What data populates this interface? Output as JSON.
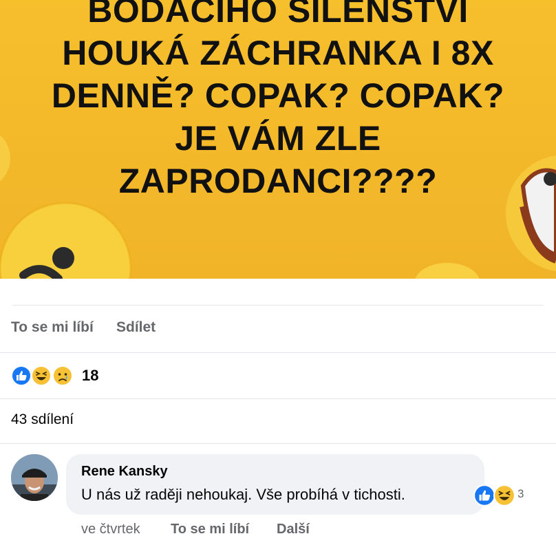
{
  "post_image": {
    "lines": [
      "BODACÍHO ŠÍLENSTVÍ",
      "HOUKÁ ZÁCHRANKA I 8X",
      "DENNĚ? COPAK? COPAK?",
      "JE VÁM ZLE",
      "ZAPRODANCI????"
    ],
    "background_color": "#f4ba2b"
  },
  "actions": {
    "like_label": "To se mi líbí",
    "share_label": "Sdílet"
  },
  "reactions": {
    "icons": [
      "like-reaction-icon",
      "haha-reaction-icon",
      "sad-reaction-icon"
    ],
    "count": "18"
  },
  "shares": {
    "text": "43 sdílení"
  },
  "comment": {
    "author": "Rene Kansky",
    "text": "U nás už raději nehoukaj. Vše probíhá v tichosti.",
    "reaction_icons": [
      "like-reaction-icon",
      "haha-reaction-icon"
    ],
    "reaction_count": "3",
    "time": "ve čtvrtek",
    "like_label": "To se mi líbí",
    "more_label": "Další"
  },
  "colors": {
    "like_blue": "#1877f2",
    "emoji_yellow": "#f7c135",
    "muted_text": "#65676b"
  }
}
